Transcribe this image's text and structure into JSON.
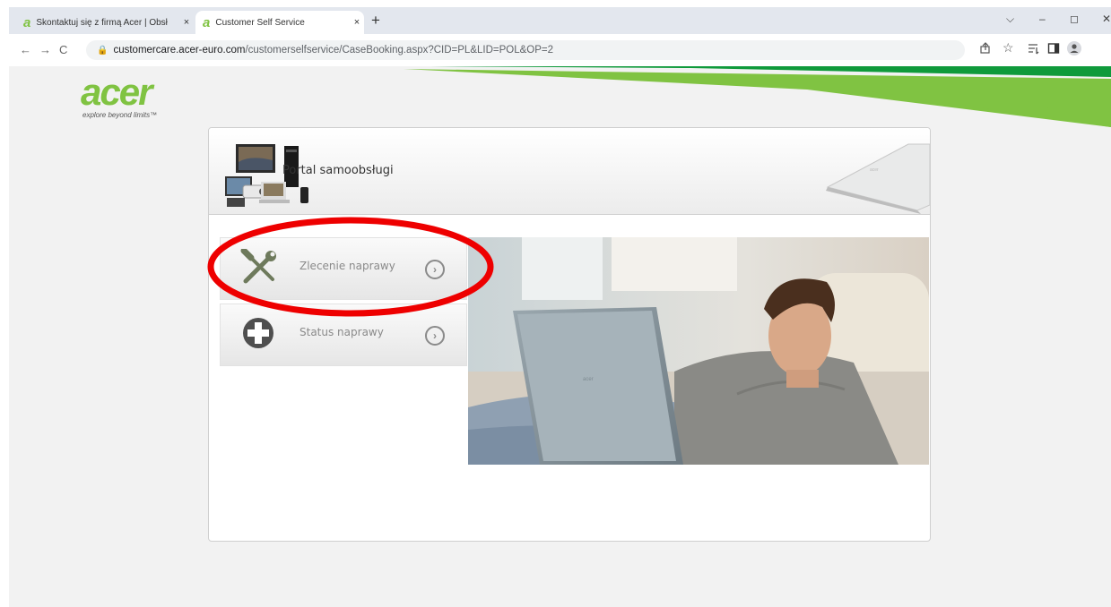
{
  "browser": {
    "tabs": [
      {
        "title": "Skontaktuj się z firmą Acer | Obsł",
        "active": false
      },
      {
        "title": "Customer Self Service",
        "active": true
      }
    ],
    "new_tab_label": "+",
    "close_tab_label": "×",
    "window_controls": {
      "dropdown": "⌵",
      "minimize": "–",
      "maximize": "◻",
      "close": "✕"
    },
    "nav": {
      "back": "←",
      "forward": "→",
      "reload": "C"
    },
    "url_host": "customercare.acer-euro.com",
    "url_path": "/customerselfservice/CaseBooking.aspx?CID=PL&LID=POL&OP=2",
    "toolbar_icons": [
      "share-icon",
      "bookmark-star-icon",
      "reading-list-icon",
      "side-panel-icon",
      "profile-icon",
      "menu-icon"
    ]
  },
  "brand": {
    "logo_text": "acer",
    "tagline": "explore beyond limits™",
    "accent_color": "#80c342",
    "accent_dark": "#3a9a3e"
  },
  "portal": {
    "title": "Portal samoobsługi",
    "menu": [
      {
        "label": "Zlecenie naprawy",
        "icon": "wrench-screwdriver-icon"
      },
      {
        "label": "Status naprawy",
        "icon": "plus-circle-icon"
      }
    ]
  },
  "annotation": {
    "color": "#ee0000",
    "shape": "ellipse"
  }
}
